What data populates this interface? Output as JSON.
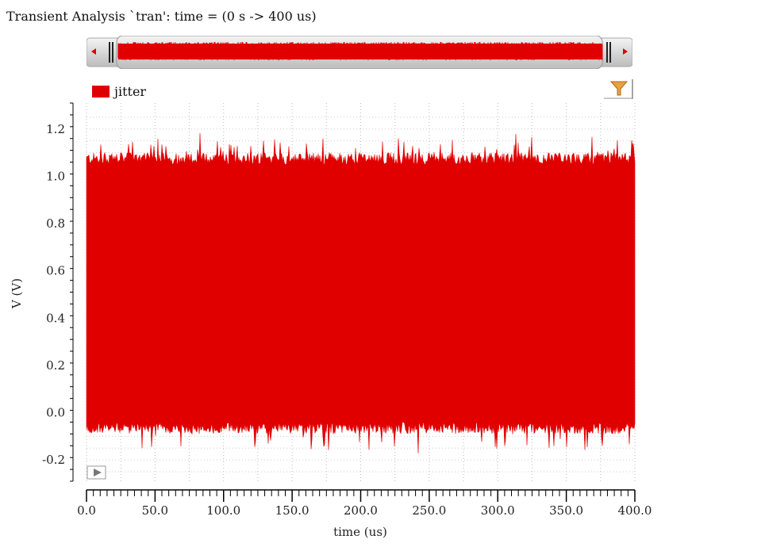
{
  "header": {
    "title": "Transient Analysis `tran': time = (0 s -> 400 us)"
  },
  "legend": {
    "items": [
      {
        "label": "jitter",
        "color": "#e00000"
      }
    ]
  },
  "icons": {
    "filter": "filter-funnel-icon",
    "scroll_left": "arrow-left-icon",
    "scroll_right": "arrow-right-icon",
    "expand": "play-triangle-icon"
  },
  "chart_data": {
    "type": "line",
    "title": "Transient Analysis `tran': time = (0 s -> 400 us)",
    "xlabel": "time (us)",
    "ylabel": "V (V)",
    "xlim": [
      0,
      400
    ],
    "ylim": [
      -0.29,
      1.31
    ],
    "xticks": [
      "0.0",
      "50.0",
      "100.0",
      "150.0",
      "200.0",
      "250.0",
      "300.0",
      "350.0",
      "400.0"
    ],
    "xtick_values": [
      0,
      50,
      100,
      150,
      200,
      250,
      300,
      350,
      400
    ],
    "yticks": [
      "-0.2",
      "0.0",
      "0.2",
      "0.4",
      "0.6",
      "0.8",
      "1.0",
      "1.2"
    ],
    "ytick_values": [
      -0.2,
      0,
      0.2,
      0.4,
      0.6,
      0.8,
      1.0,
      1.2
    ],
    "grid": true,
    "legend_position": "top-left",
    "series": [
      {
        "name": "jitter",
        "color": "#e00000",
        "description_values": {
          "high_level_typical": 1.08,
          "high_peak_max": 1.17,
          "low_level_typical": -0.07,
          "low_peak_min": -0.16
        }
      }
    ]
  }
}
